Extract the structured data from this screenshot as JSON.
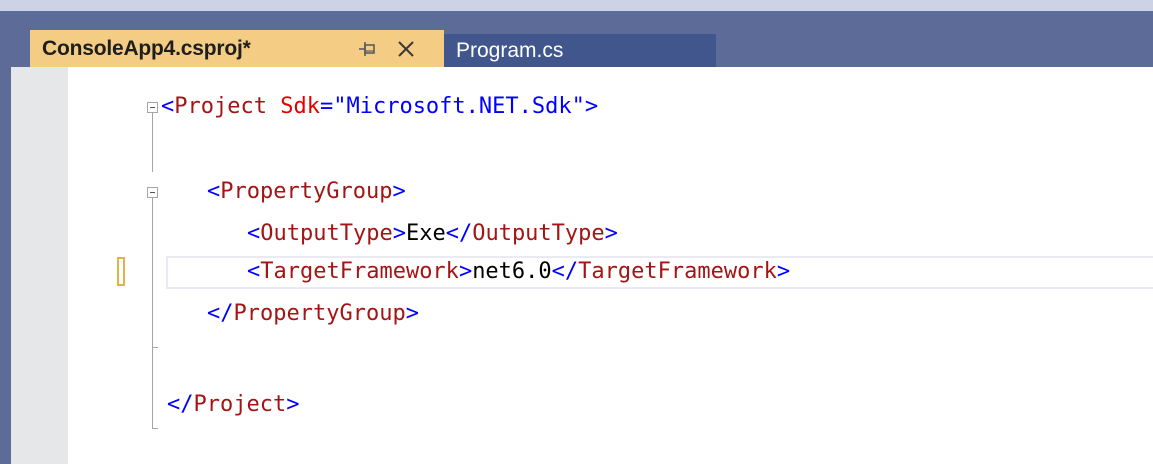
{
  "tabs": {
    "active": {
      "label": "ConsoleApp4.csproj*",
      "pin_icon": "pin-icon",
      "close_icon": "close-icon"
    },
    "inactive": {
      "label": "Program.cs"
    }
  },
  "editor": {
    "lines": {
      "l1": {
        "open": "<",
        "tag": "Project",
        "attr": "Sdk",
        "eq": "=",
        "value": "\"Microsoft.NET.Sdk\"",
        "close": ">"
      },
      "l3": {
        "open": "<",
        "tag": "PropertyGroup",
        "close": ">"
      },
      "l4": {
        "open": "<",
        "tag": "OutputType",
        "close": ">",
        "text": "Exe",
        "endopen": "</",
        "endtag": "OutputType",
        "endclose": ">"
      },
      "l5": {
        "open": "<",
        "tag": "TargetFramework",
        "close": ">",
        "text": "net6.0",
        "endopen": "</",
        "endtag": "TargetFramework",
        "endclose": ">"
      },
      "l6": {
        "open": "</",
        "tag": "PropertyGroup",
        "close": ">"
      },
      "l8": {
        "open": "</",
        "tag": "Project",
        "close": ">"
      }
    }
  },
  "colors": {
    "tab_active_bg": "#f5cc84",
    "tab_inactive_bg": "#40568d",
    "chrome_bg": "#5d6b99",
    "xml_tag": "#a31515",
    "xml_attr": "#e50000",
    "xml_punct": "#0000ff",
    "change_marker": "#e2b24a"
  }
}
